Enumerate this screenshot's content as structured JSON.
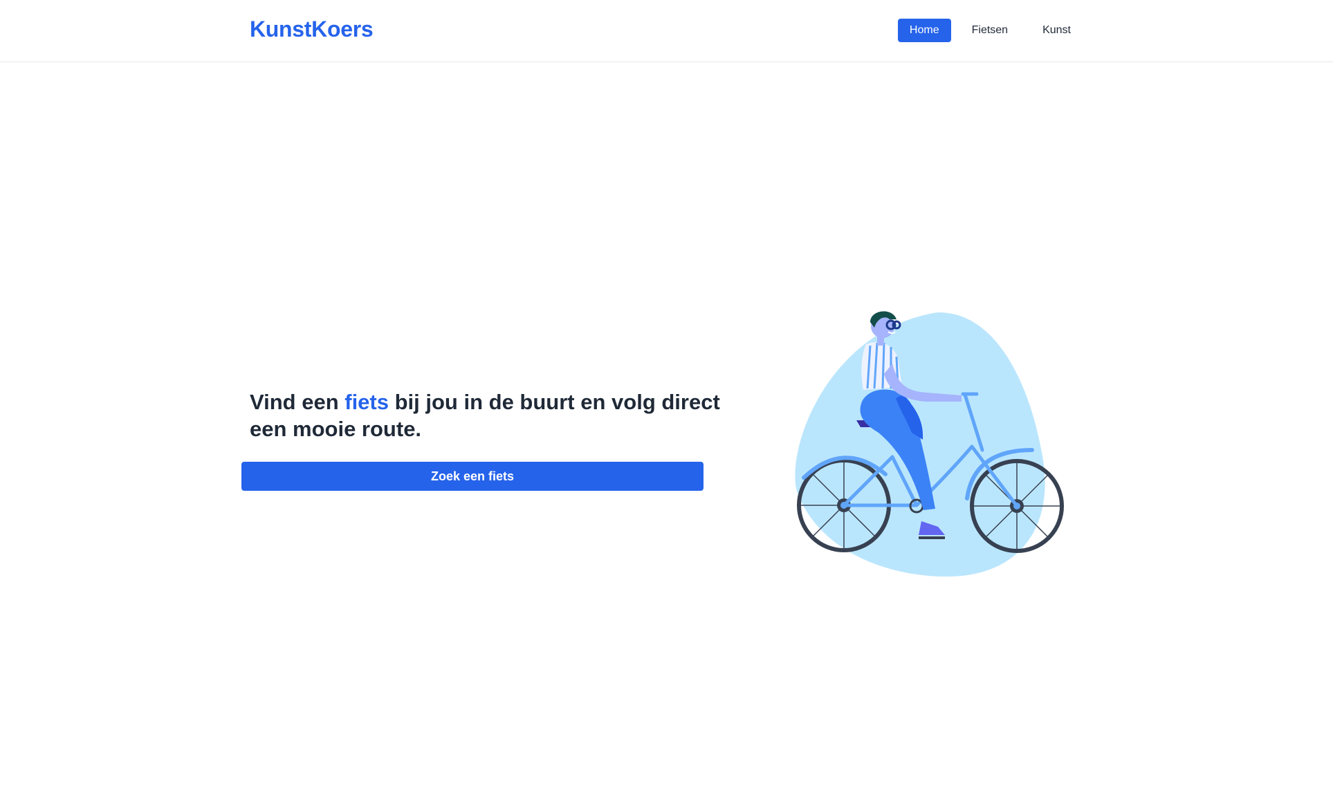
{
  "header": {
    "brand": "KunstKoers",
    "nav": [
      {
        "label": "Home",
        "active": true
      },
      {
        "label": "Fietsen",
        "active": false
      },
      {
        "label": "Kunst",
        "active": false
      }
    ]
  },
  "hero": {
    "headline_before": "Vind een ",
    "headline_accent": "fiets",
    "headline_after": " bij jou in de buurt en volg direct een mooie route.",
    "cta_label": "Zoek een fiets",
    "illustration": "woman-riding-bicycle-illustration"
  },
  "colors": {
    "accent": "#2563eb",
    "text": "#1f2937",
    "blob": "#bae6fd",
    "bike": "#60a5fa",
    "wheel": "#374151"
  }
}
